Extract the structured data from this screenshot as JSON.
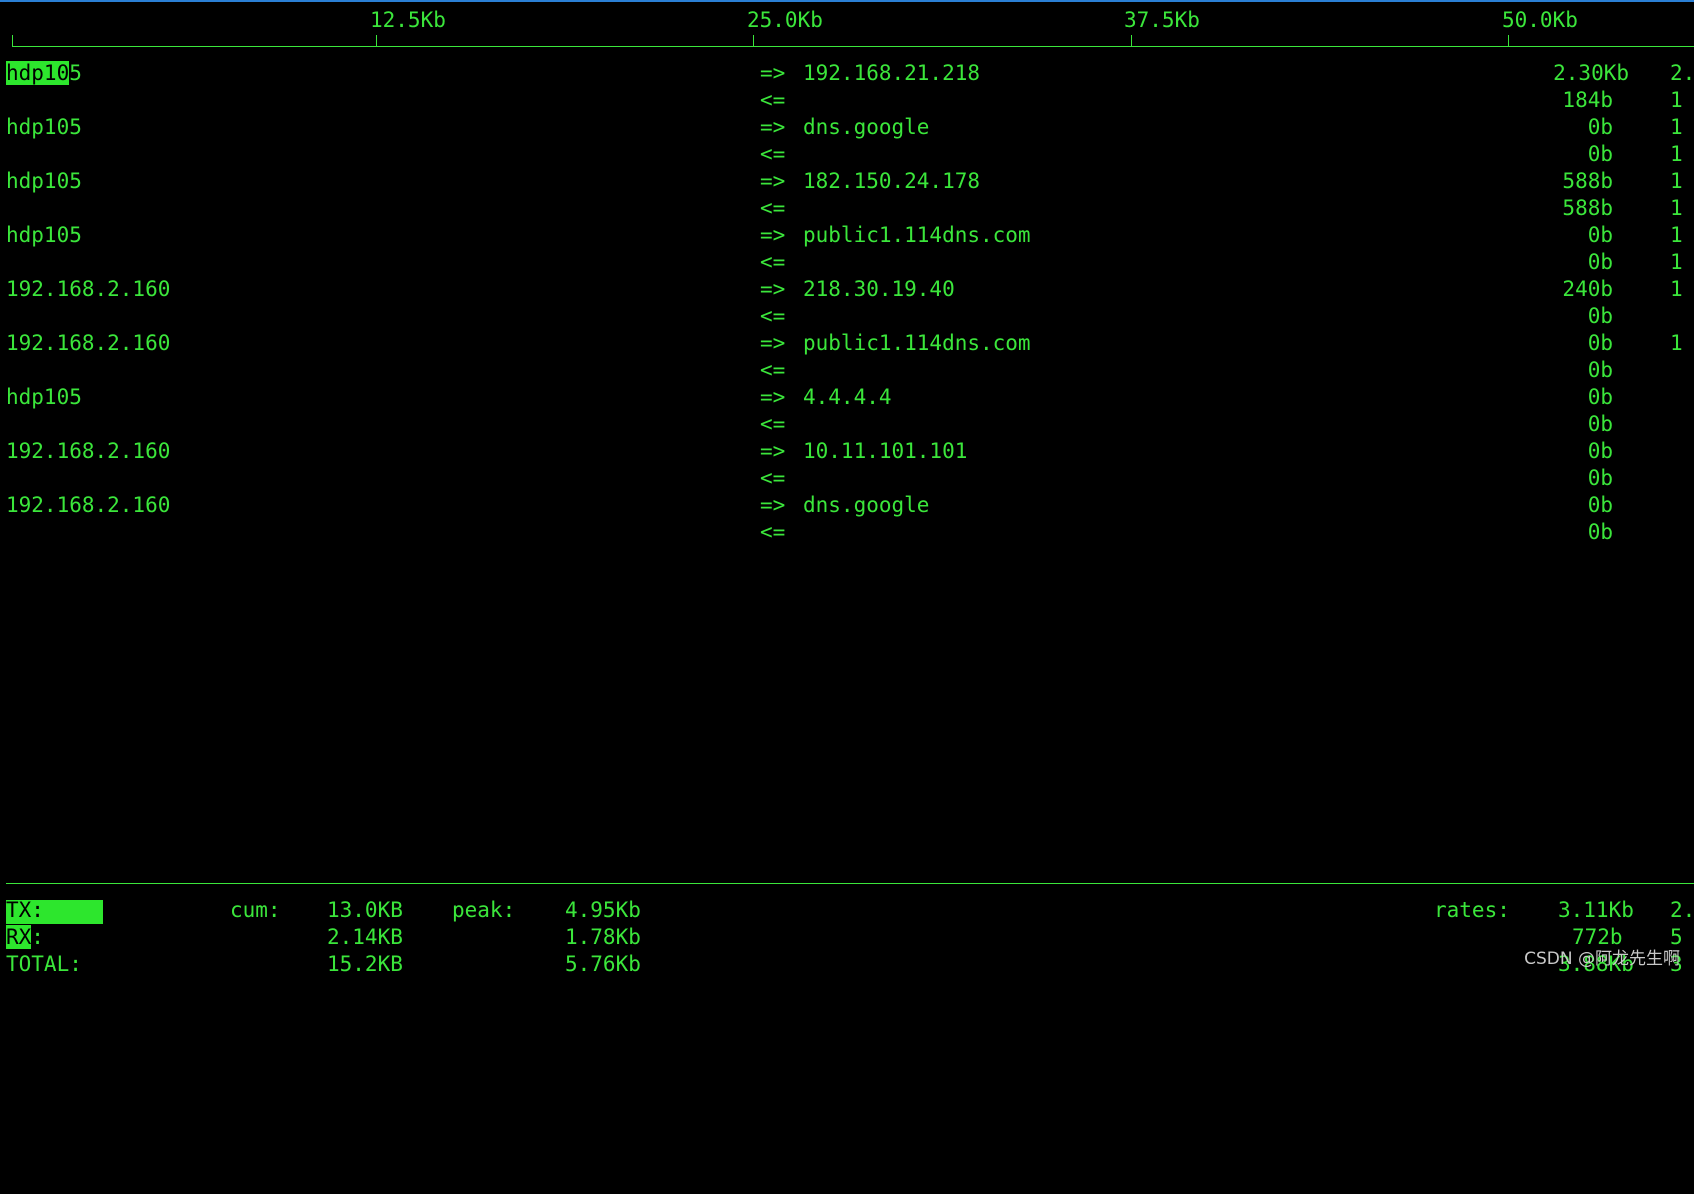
{
  "colors": {
    "foreground": "#3be63b",
    "background": "#000000",
    "highlight": "#2de62d",
    "top_border": "#2a7fd4"
  },
  "scale": {
    "labels": [
      "12.5Kb",
      "25.0Kb",
      "37.5Kb",
      "50.0Kb"
    ]
  },
  "connections": [
    {
      "src_hl": "hdp10",
      "src": "5",
      "out_arrow": "=>",
      "dst": "192.168.21.218",
      "in_arrow": "<=",
      "tx_rate": "2.30Kb",
      "tx_rate2": "2.",
      "rx_rate": "184b",
      "rx_rate2": "1"
    },
    {
      "src_hl": "",
      "src": "hdp105",
      "out_arrow": "=>",
      "dst": "dns.google",
      "in_arrow": "<=",
      "tx_rate": "0b",
      "tx_rate2": "1",
      "rx_rate": "0b",
      "rx_rate2": "1"
    },
    {
      "src_hl": "",
      "src": "hdp105",
      "out_arrow": "=>",
      "dst": "182.150.24.178",
      "in_arrow": "<=",
      "tx_rate": "588b",
      "tx_rate2": "1",
      "rx_rate": "588b",
      "rx_rate2": "1"
    },
    {
      "src_hl": "",
      "src": "hdp105",
      "out_arrow": "=>",
      "dst": "public1.114dns.com",
      "in_arrow": "<=",
      "tx_rate": "0b",
      "tx_rate2": "1",
      "rx_rate": "0b",
      "rx_rate2": "1"
    },
    {
      "src_hl": "",
      "src": "192.168.2.160",
      "out_arrow": "=>",
      "dst": "218.30.19.40",
      "in_arrow": "<=",
      "tx_rate": "240b",
      "tx_rate2": "1",
      "rx_rate": "0b",
      "rx_rate2": ""
    },
    {
      "src_hl": "",
      "src": "192.168.2.160",
      "out_arrow": "=>",
      "dst": "public1.114dns.com",
      "in_arrow": "<=",
      "tx_rate": "0b",
      "tx_rate2": "1",
      "rx_rate": "0b",
      "rx_rate2": ""
    },
    {
      "src_hl": "",
      "src": "hdp105",
      "out_arrow": "=>",
      "dst": "4.4.4.4",
      "in_arrow": "<=",
      "tx_rate": "0b",
      "tx_rate2": "",
      "rx_rate": "0b",
      "rx_rate2": ""
    },
    {
      "src_hl": "",
      "src": "192.168.2.160",
      "out_arrow": "=>",
      "dst": "10.11.101.101",
      "in_arrow": "<=",
      "tx_rate": "0b",
      "tx_rate2": "",
      "rx_rate": "0b",
      "rx_rate2": ""
    },
    {
      "src_hl": "",
      "src": "192.168.2.160",
      "out_arrow": "=>",
      "dst": "dns.google",
      "in_arrow": "<=",
      "tx_rate": "0b",
      "tx_rate2": "",
      "rx_rate": "0b",
      "rx_rate2": ""
    }
  ],
  "totals": {
    "tx": {
      "label_hl": "TX:",
      "label": "",
      "cum": "13.0KB",
      "peak": "4.95Kb",
      "rate": "3.11Kb",
      "rate2": "2."
    },
    "rx": {
      "label_hl": "RX",
      "label": ":",
      "cum": "2.14KB",
      "peak": "1.78Kb",
      "rate": "772b",
      "rate2": "5"
    },
    "total": {
      "label_hl": "",
      "label": "TOTAL:",
      "cum": "15.2KB",
      "peak": "5.76Kb",
      "rate": "3.88Kb",
      "rate2": "3"
    },
    "cum_label": "cum:",
    "peak_label": "peak:",
    "rates_label": "rates:"
  },
  "watermark": "CSDN @阿龙先生啊"
}
